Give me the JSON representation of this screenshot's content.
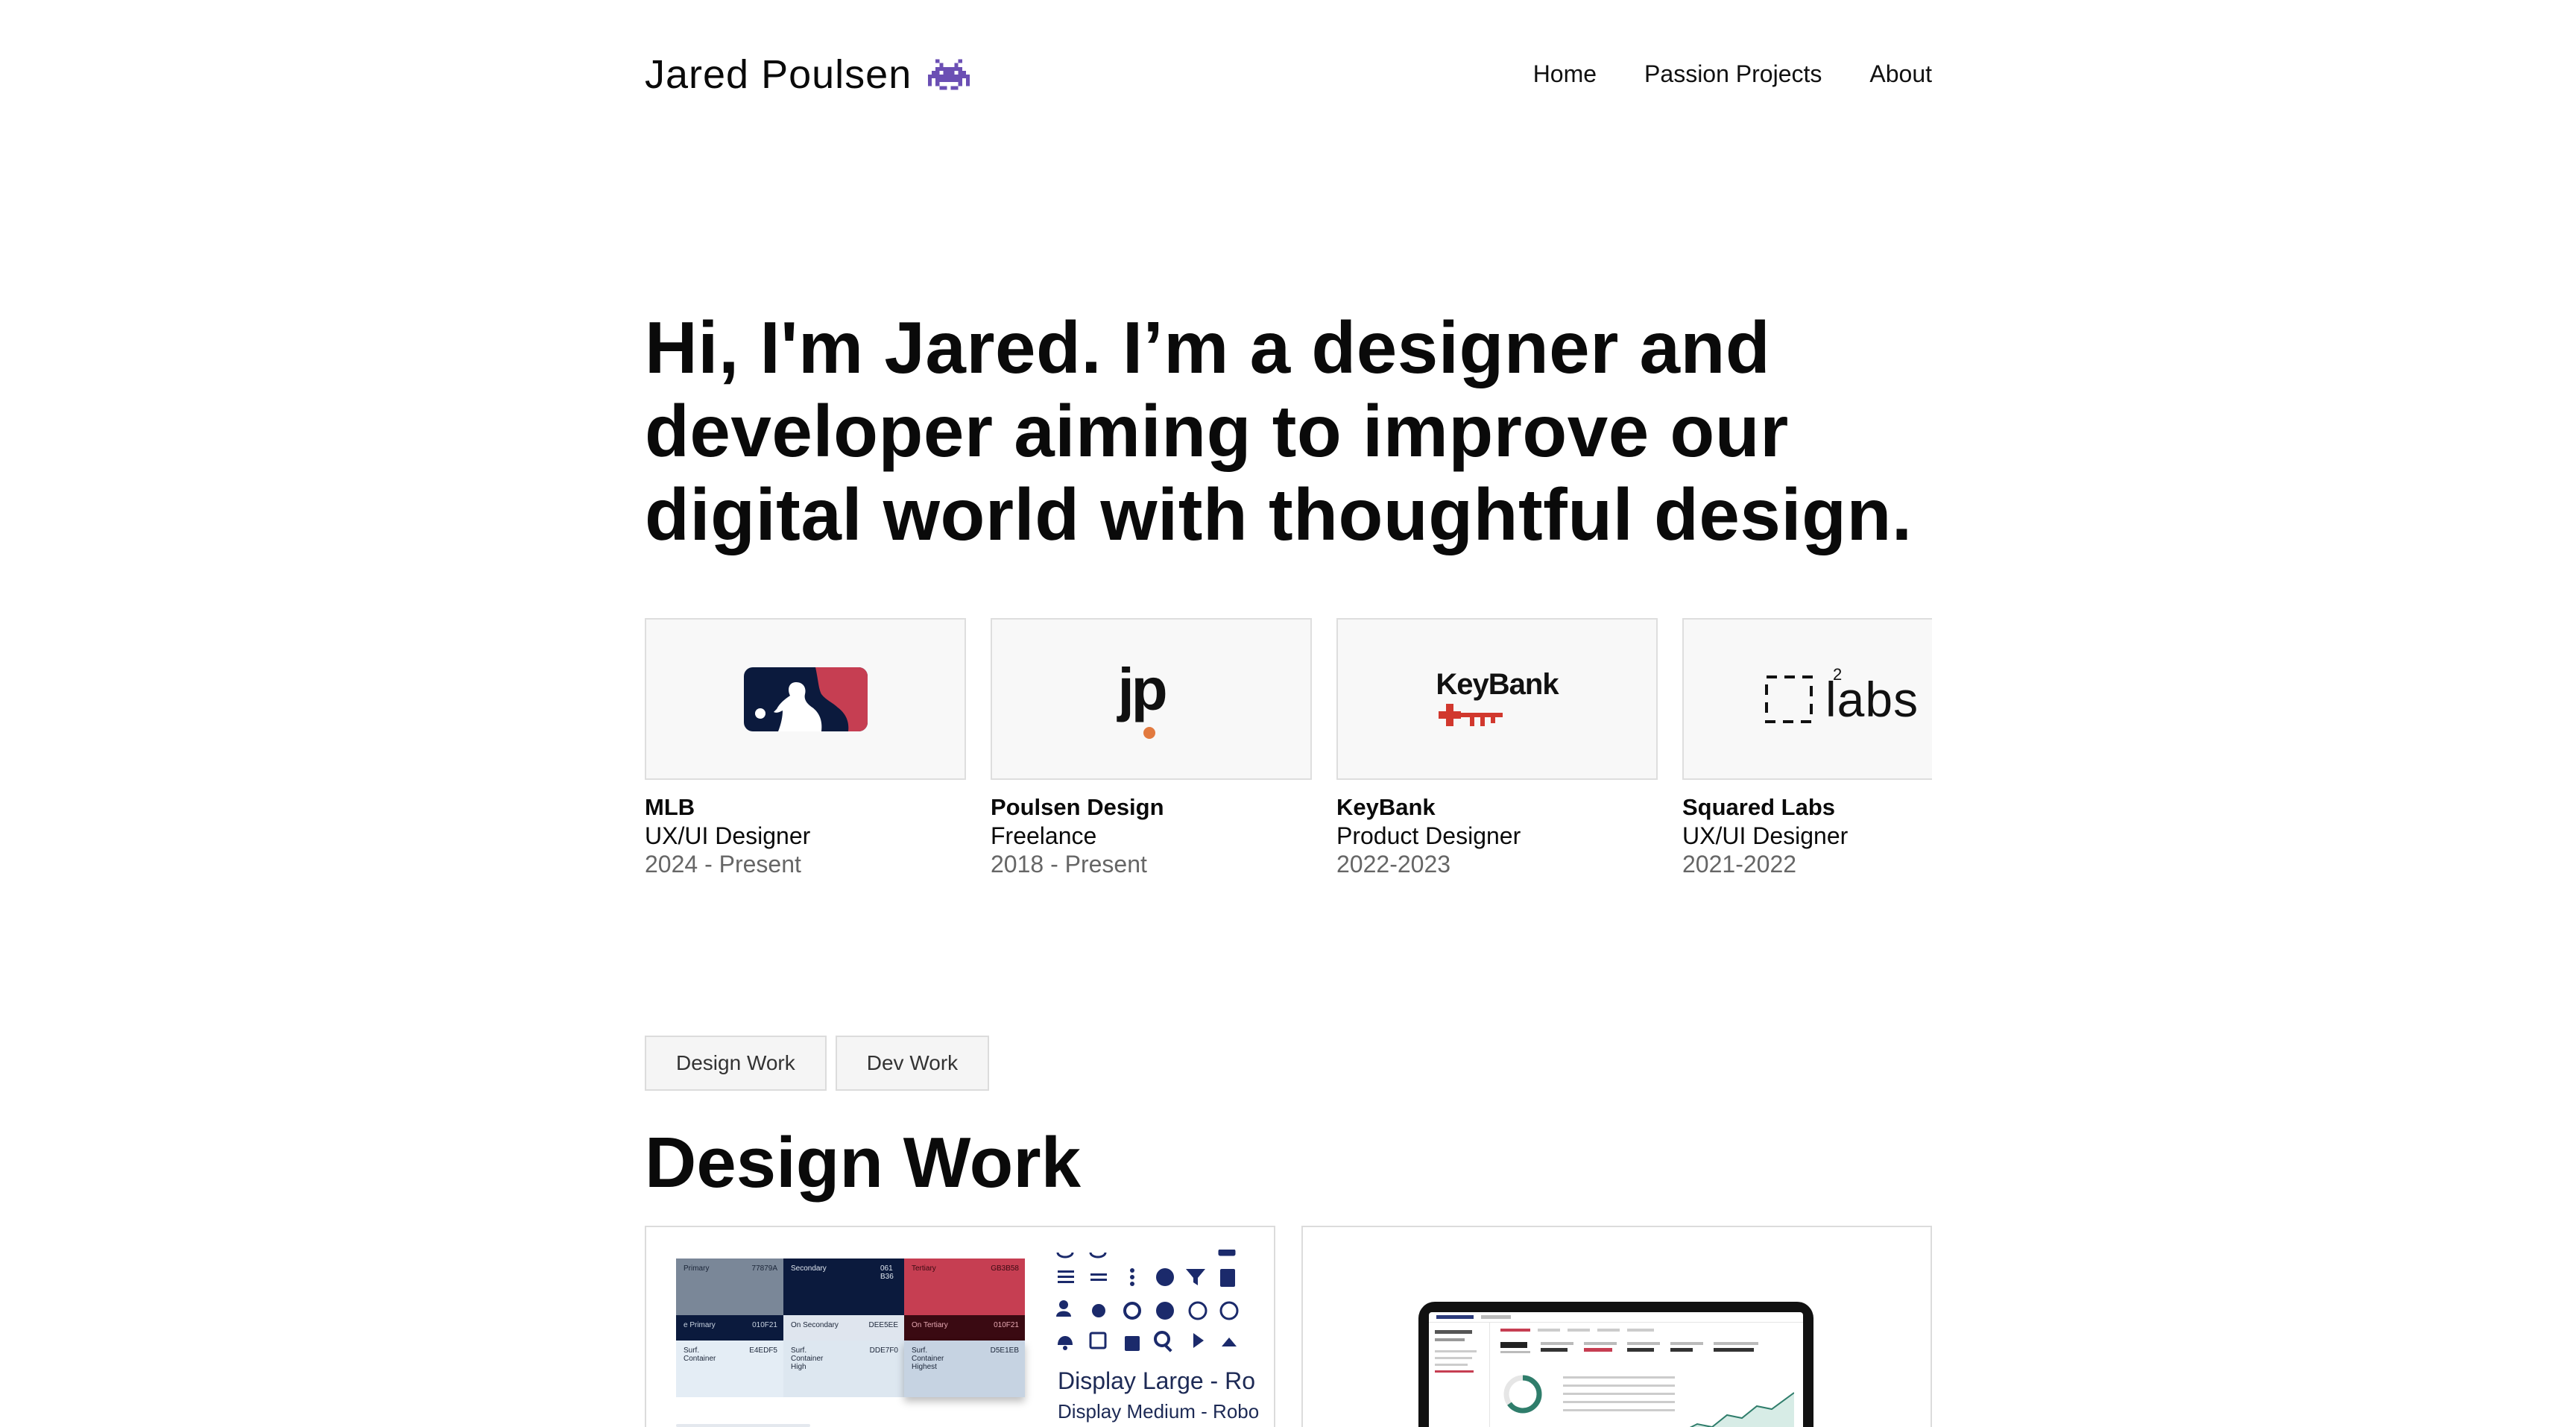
{
  "header": {
    "name": "Jared Poulsen",
    "nav": [
      "Home",
      "Passion Projects",
      "About"
    ]
  },
  "hero": {
    "text": "Hi, I'm Jared. I’m a designer and developer aiming to improve our digital world with thoughtful design."
  },
  "experience": [
    {
      "company": "MLB",
      "role": "UX/UI Designer",
      "years": "2024 - Present",
      "logo": "mlb-logo"
    },
    {
      "company": "Poulsen Design",
      "role": "Freelance",
      "years": "2018 - Present",
      "logo": "jp-logo"
    },
    {
      "company": "KeyBank",
      "role": "Product Designer",
      "years": "2022-2023",
      "logo": "keybank-logo"
    },
    {
      "company": "Squared Labs",
      "role": "UX/UI Designer",
      "years": "2021-2022",
      "logo": "squared-labs-logo"
    }
  ],
  "logos": {
    "jp": "jp",
    "keybank": "KeyBank",
    "labs": "labs",
    "labs_sup": "2"
  },
  "filters": [
    "Design Work",
    "Dev Work"
  ],
  "section_title": "Design Work",
  "work_card_1": {
    "palette": {
      "primary": "Primary",
      "primary_hex": "77879A",
      "secondary": "Secondary",
      "secondary_hex": "061 B36",
      "tertiary": "Tertiary",
      "tertiary_hex": "GB3B58",
      "on_primary": "e Primary",
      "on_primary_hex": "010F21",
      "on_secondary": "On Secondary",
      "on_secondary_hex": "DEE5EE",
      "on_tertiary": "On Tertiary",
      "on_tertiary_hex": "010F21",
      "surf_container": "Surf. Container",
      "surf_container_hex": "E4EDF5",
      "surf_container_high": "Surf. Container High",
      "surf_container_high_hex": "DDE7F0",
      "surf_container_highest": "Surf. Container Highest",
      "surf_container_highest_hex": "D5E1EB"
    },
    "type_large": "Display Large - Ro",
    "type_medium": "Display Medium - Robo"
  },
  "colors": {
    "navy": "#0b1a3d",
    "red": "#c63e52",
    "keybank_red": "#d1382e",
    "jp_orange": "#e27a3f"
  }
}
